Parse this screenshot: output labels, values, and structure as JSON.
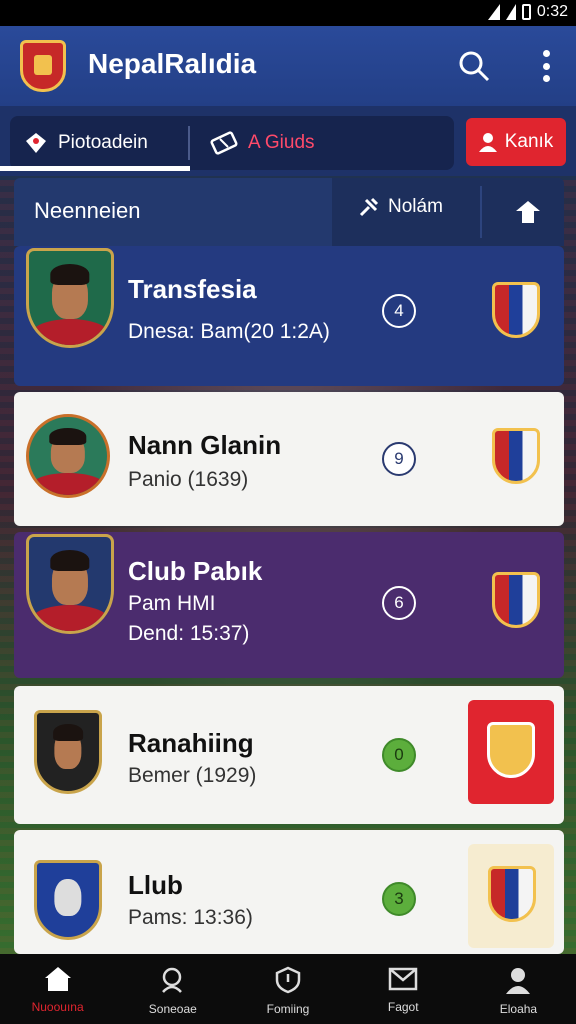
{
  "status_bar": {
    "time": "0:32"
  },
  "app": {
    "title": "NepalRalıdia"
  },
  "tabs": {
    "tab1_label": "Piotoadein",
    "tab2_label": "A Giuds",
    "action_label": "Kanık"
  },
  "section": {
    "title": "Neenneien",
    "notice_label": "Nolám"
  },
  "cards": [
    {
      "title": "Transfesia",
      "line1": "Dnesa: Bam(20 1:2A)",
      "badge": "4"
    },
    {
      "title": "Nann Glanin",
      "line1": "Panio (1639)",
      "badge": "9"
    },
    {
      "title": "Club Pabık",
      "line1": "Pam HMI",
      "line2": "Dend: 15:37)",
      "badge": "6"
    },
    {
      "title": "Ranahiing",
      "line1": "Bemer (1929)",
      "badge": "0"
    },
    {
      "title": "Llub",
      "line1": "Pams: 13:36)",
      "badge": "3"
    }
  ],
  "bottom_nav": [
    {
      "label": "Nuoouına"
    },
    {
      "label": "Soneoae"
    },
    {
      "label": "Fomiing"
    },
    {
      "label": "Fagot"
    },
    {
      "label": "Eloaha"
    }
  ],
  "colors": {
    "accent_red": "#e0252f",
    "app_bar_blue": "#2a4a9a",
    "purple_card": "#4b2c6e"
  }
}
